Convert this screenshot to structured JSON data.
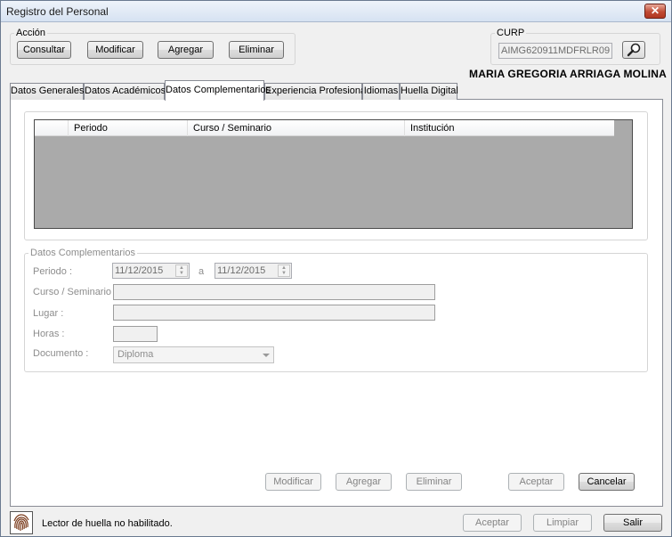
{
  "window": {
    "title": "Registro del Personal",
    "close_label": "✕"
  },
  "accion": {
    "legend": "Acción",
    "buttons": {
      "consultar": "Consultar",
      "modificar": "Modificar",
      "agregar": "Agregar",
      "eliminar": "Eliminar"
    }
  },
  "curp": {
    "legend": "CURP",
    "value": "AIMG620911MDFRLR09",
    "search_icon": "search-icon"
  },
  "person_name": "MARIA GREGORIA ARRIAGA MOLINA",
  "tabs": [
    {
      "label": "Datos Generales",
      "active": false
    },
    {
      "label": "Datos Académicos",
      "active": false
    },
    {
      "label": "Datos Complementarios",
      "active": true
    },
    {
      "label": "Experiencia Profesional",
      "active": false
    },
    {
      "label": "Idiomas",
      "active": false
    },
    {
      "label": "Huella Digital",
      "active": false
    }
  ],
  "grid": {
    "columns": [
      "",
      "Periodo",
      "Curso / Seminario",
      "Institución"
    ],
    "rows": []
  },
  "form": {
    "legend": "Datos Complementarios",
    "periodo_label": "Periodo :",
    "fecha_inicio": "11/12/2015",
    "separator": "a",
    "fecha_fin": "11/12/2015",
    "curso_label": "Curso / Seminario :",
    "curso_value": "",
    "lugar_label": "Lugar :",
    "lugar_value": "",
    "horas_label": "Horas :",
    "horas_value": "",
    "documento_label": "Documento :",
    "documento_value": "Diploma"
  },
  "panel_buttons": {
    "modificar": "Modificar",
    "agregar": "Agregar",
    "eliminar": "Eliminar",
    "aceptar": "Aceptar",
    "cancelar": "Cancelar"
  },
  "footer": {
    "fingerprint_icon": "fingerprint-icon",
    "status": "Lector de huella no habilitado.",
    "aceptar": "Aceptar",
    "limpiar": "Limpiar",
    "salir": "Salir"
  }
}
